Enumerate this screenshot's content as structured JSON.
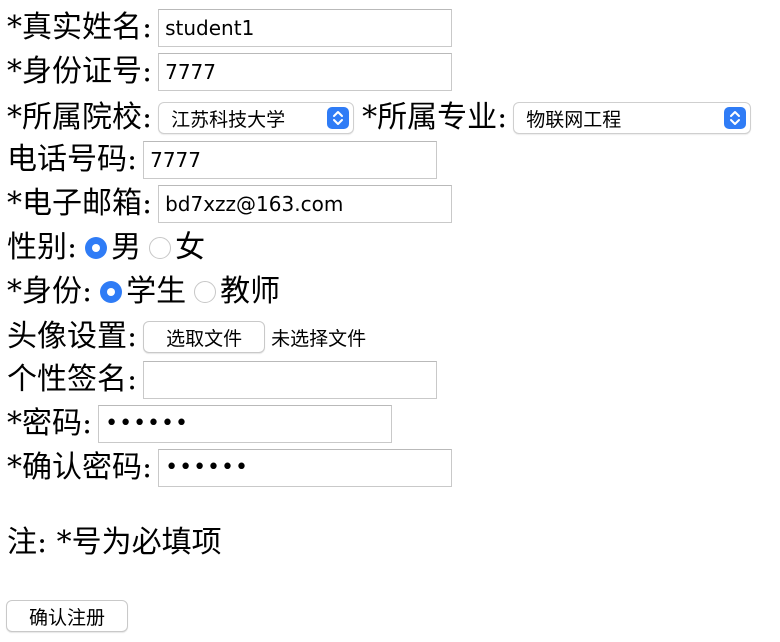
{
  "form": {
    "real_name": {
      "label": "*真实姓名:",
      "value": "student1"
    },
    "id_number": {
      "label": "*身份证号:",
      "value": "7777"
    },
    "college": {
      "label": "*所属院校:",
      "selected": "江苏科技大学"
    },
    "major": {
      "label": "*所属专业:",
      "selected": "物联网工程"
    },
    "phone": {
      "label": "电话号码:",
      "value": "7777"
    },
    "email": {
      "label": "*电子邮箱:",
      "value": "bd7xzz@163.com"
    },
    "gender": {
      "label": "性别:",
      "options": [
        {
          "label": "男",
          "checked": true
        },
        {
          "label": "女",
          "checked": false
        }
      ]
    },
    "identity": {
      "label": "*身份:",
      "options": [
        {
          "label": "学生",
          "checked": true
        },
        {
          "label": "教师",
          "checked": false
        }
      ]
    },
    "avatar": {
      "label": "头像设置:",
      "button_label": "选取文件",
      "status": "未选择文件"
    },
    "signature": {
      "label": "个性签名:",
      "value": ""
    },
    "password": {
      "label": "*密码:",
      "masked_value": "••••••"
    },
    "confirm_password": {
      "label": "*确认密码:",
      "masked_value": "••••••"
    },
    "note": "注: *号为必填项",
    "submit_label": "确认注册"
  },
  "colors": {
    "accent": "#2f7cf6",
    "input_border": "#c9c9c9"
  }
}
